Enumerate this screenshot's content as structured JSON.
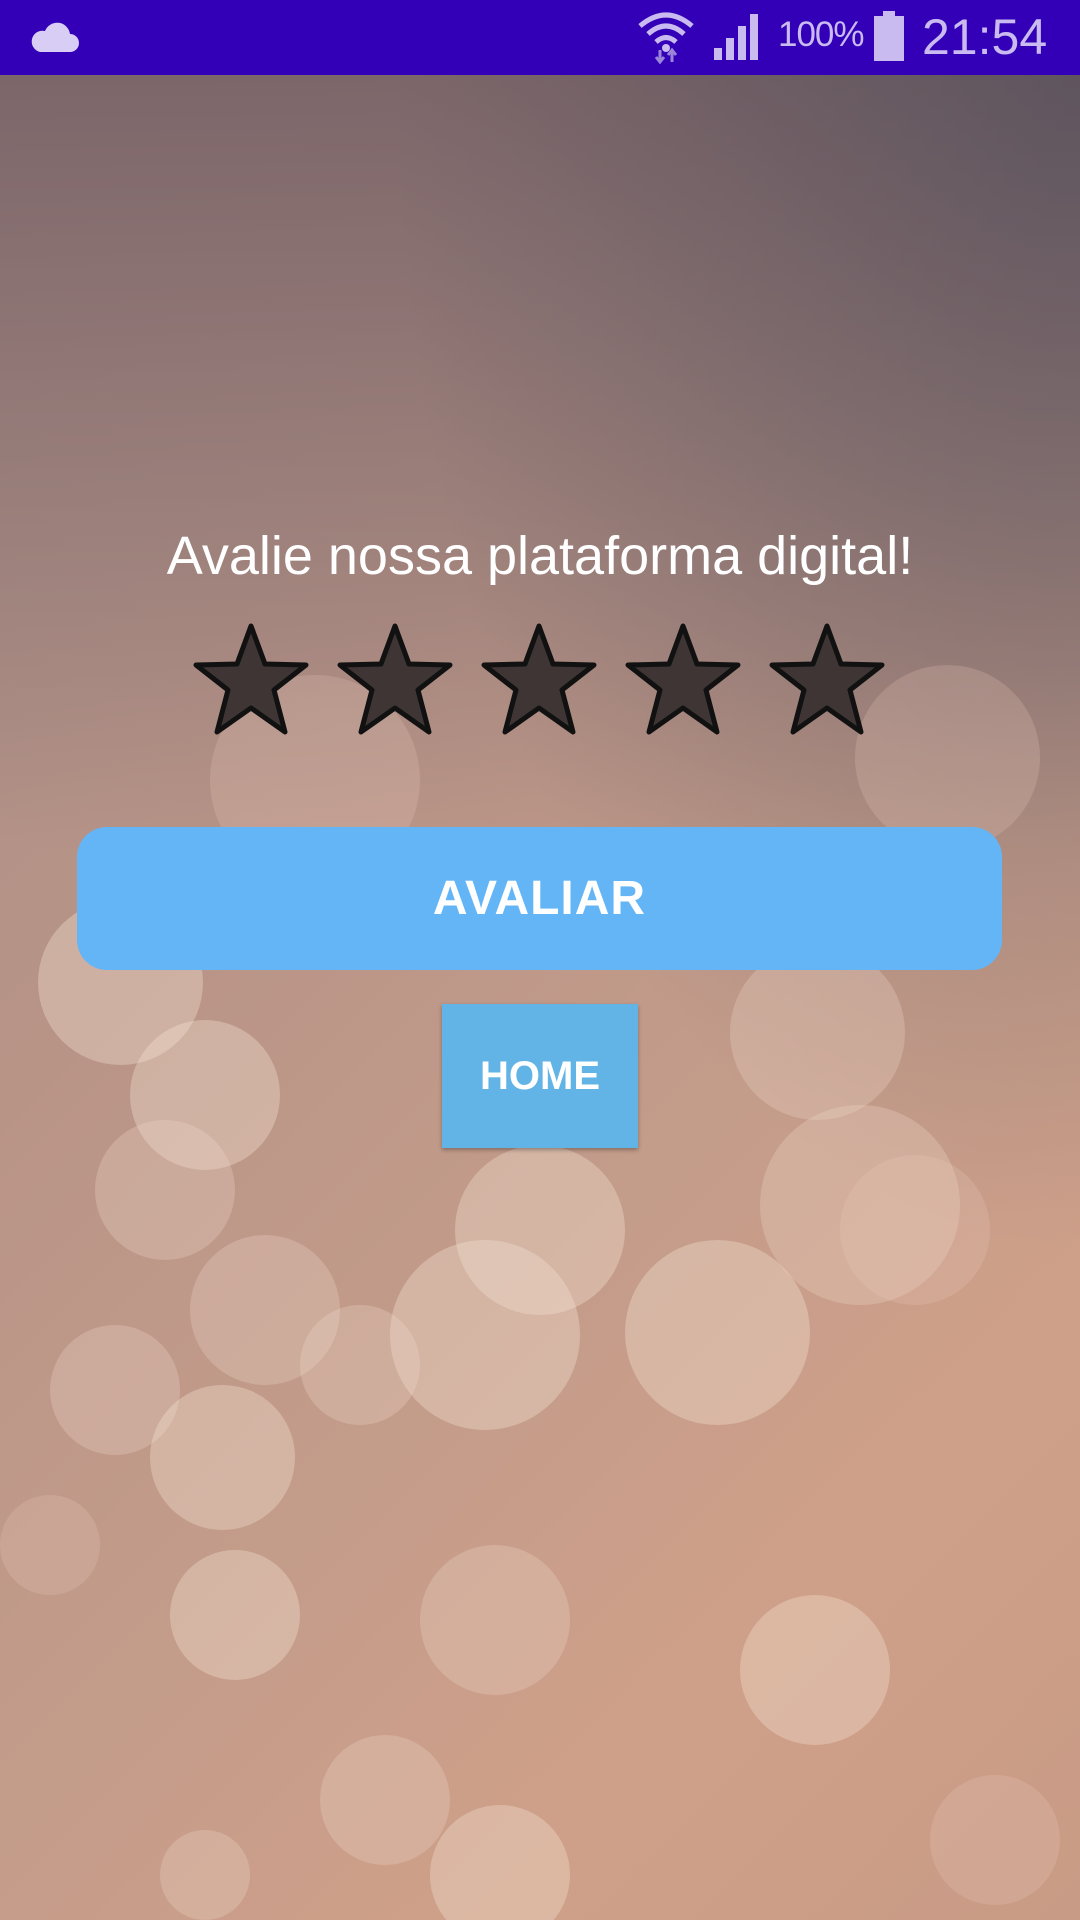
{
  "status_bar": {
    "battery_percent": "100%",
    "time": "21:54",
    "background_color": "#3300b8",
    "icons": [
      "cloud-icon",
      "wifi-icon",
      "signal-icon",
      "battery-icon"
    ]
  },
  "rating": {
    "title": "Avalie nossa plataforma digital!",
    "max_stars": 5,
    "selected_stars": 0
  },
  "buttons": {
    "rate_label": "AVALIAR",
    "home_label": "HOME"
  },
  "colors": {
    "rate_button": "#64b5f6",
    "home_button": "#62b4e6",
    "star_fill": "#3e3534",
    "star_outline": "#111111"
  }
}
